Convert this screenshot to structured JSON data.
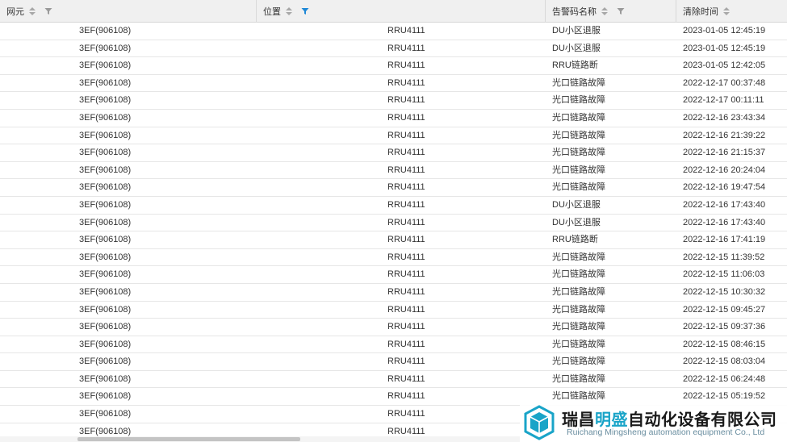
{
  "columns": [
    {
      "key": "ne",
      "label": "网元",
      "sortable": true,
      "filter_active": false
    },
    {
      "key": "position",
      "label": "位置",
      "sortable": true,
      "filter_active": true
    },
    {
      "key": "alarm",
      "label": "告警码名称",
      "sortable": true,
      "filter_active": false
    },
    {
      "key": "clear_time",
      "label": "清除时间",
      "sortable": true,
      "filter_active": false
    }
  ],
  "rows": [
    {
      "ne": "3EF(906108)",
      "position": "RRU4111",
      "alarm": "DU小区退服",
      "clear_time": "2023-01-05 12:45:19"
    },
    {
      "ne": "3EF(906108)",
      "position": "RRU4111",
      "alarm": "DU小区退服",
      "clear_time": "2023-01-05 12:45:19"
    },
    {
      "ne": "3EF(906108)",
      "position": "RRU4111",
      "alarm": "RRU链路断",
      "clear_time": "2023-01-05 12:42:05"
    },
    {
      "ne": "3EF(906108)",
      "position": "RRU4111",
      "alarm": "光口链路故障",
      "clear_time": "2022-12-17 00:37:48"
    },
    {
      "ne": "3EF(906108)",
      "position": "RRU4111",
      "alarm": "光口链路故障",
      "clear_time": "2022-12-17 00:11:11"
    },
    {
      "ne": "3EF(906108)",
      "position": "RRU4111",
      "alarm": "光口链路故障",
      "clear_time": "2022-12-16 23:43:34"
    },
    {
      "ne": "3EF(906108)",
      "position": "RRU4111",
      "alarm": "光口链路故障",
      "clear_time": "2022-12-16 21:39:22"
    },
    {
      "ne": "3EF(906108)",
      "position": "RRU4111",
      "alarm": "光口链路故障",
      "clear_time": "2022-12-16 21:15:37"
    },
    {
      "ne": "3EF(906108)",
      "position": "RRU4111",
      "alarm": "光口链路故障",
      "clear_time": "2022-12-16 20:24:04"
    },
    {
      "ne": "3EF(906108)",
      "position": "RRU4111",
      "alarm": "光口链路故障",
      "clear_time": "2022-12-16 19:47:54"
    },
    {
      "ne": "3EF(906108)",
      "position": "RRU4111",
      "alarm": "DU小区退服",
      "clear_time": "2022-12-16 17:43:40"
    },
    {
      "ne": "3EF(906108)",
      "position": "RRU4111",
      "alarm": "DU小区退服",
      "clear_time": "2022-12-16 17:43:40"
    },
    {
      "ne": "3EF(906108)",
      "position": "RRU4111",
      "alarm": "RRU链路断",
      "clear_time": "2022-12-16 17:41:19"
    },
    {
      "ne": "3EF(906108)",
      "position": "RRU4111",
      "alarm": "光口链路故障",
      "clear_time": "2022-12-15 11:39:52"
    },
    {
      "ne": "3EF(906108)",
      "position": "RRU4111",
      "alarm": "光口链路故障",
      "clear_time": "2022-12-15 11:06:03"
    },
    {
      "ne": "3EF(906108)",
      "position": "RRU4111",
      "alarm": "光口链路故障",
      "clear_time": "2022-12-15 10:30:32"
    },
    {
      "ne": "3EF(906108)",
      "position": "RRU4111",
      "alarm": "光口链路故障",
      "clear_time": "2022-12-15 09:45:27"
    },
    {
      "ne": "3EF(906108)",
      "position": "RRU4111",
      "alarm": "光口链路故障",
      "clear_time": "2022-12-15 09:37:36"
    },
    {
      "ne": "3EF(906108)",
      "position": "RRU4111",
      "alarm": "光口链路故障",
      "clear_time": "2022-12-15 08:46:15"
    },
    {
      "ne": "3EF(906108)",
      "position": "RRU4111",
      "alarm": "光口链路故障",
      "clear_time": "2022-12-15 08:03:04"
    },
    {
      "ne": "3EF(906108)",
      "position": "RRU4111",
      "alarm": "光口链路故障",
      "clear_time": "2022-12-15 06:24:48"
    },
    {
      "ne": "3EF(906108)",
      "position": "RRU4111",
      "alarm": "光口链路故障",
      "clear_time": "2022-12-15 05:19:52"
    },
    {
      "ne": "3EF(906108)",
      "position": "RRU4111",
      "alarm": "",
      "clear_time": ""
    },
    {
      "ne": "3EF(906108)",
      "position": "RRU4111",
      "alarm": "",
      "clear_time": ""
    }
  ],
  "watermark": {
    "cn_prefix": "瑞昌",
    "cn_highlight": "明盛",
    "cn_suffix": "自动化设备有限公司",
    "en": "Ruichang Mingsheng automation equipment Co., Ltd"
  },
  "colors": {
    "header_bg": "#f0f0f0",
    "filter_active": "#1e88d6",
    "filter_inactive": "#9a9a9a",
    "watermark_accent": "#19a4c8"
  },
  "icons": {
    "sort": "sort-up-down-icon",
    "filter": "funnel-filter-icon",
    "logo": "cube-logo-icon"
  }
}
